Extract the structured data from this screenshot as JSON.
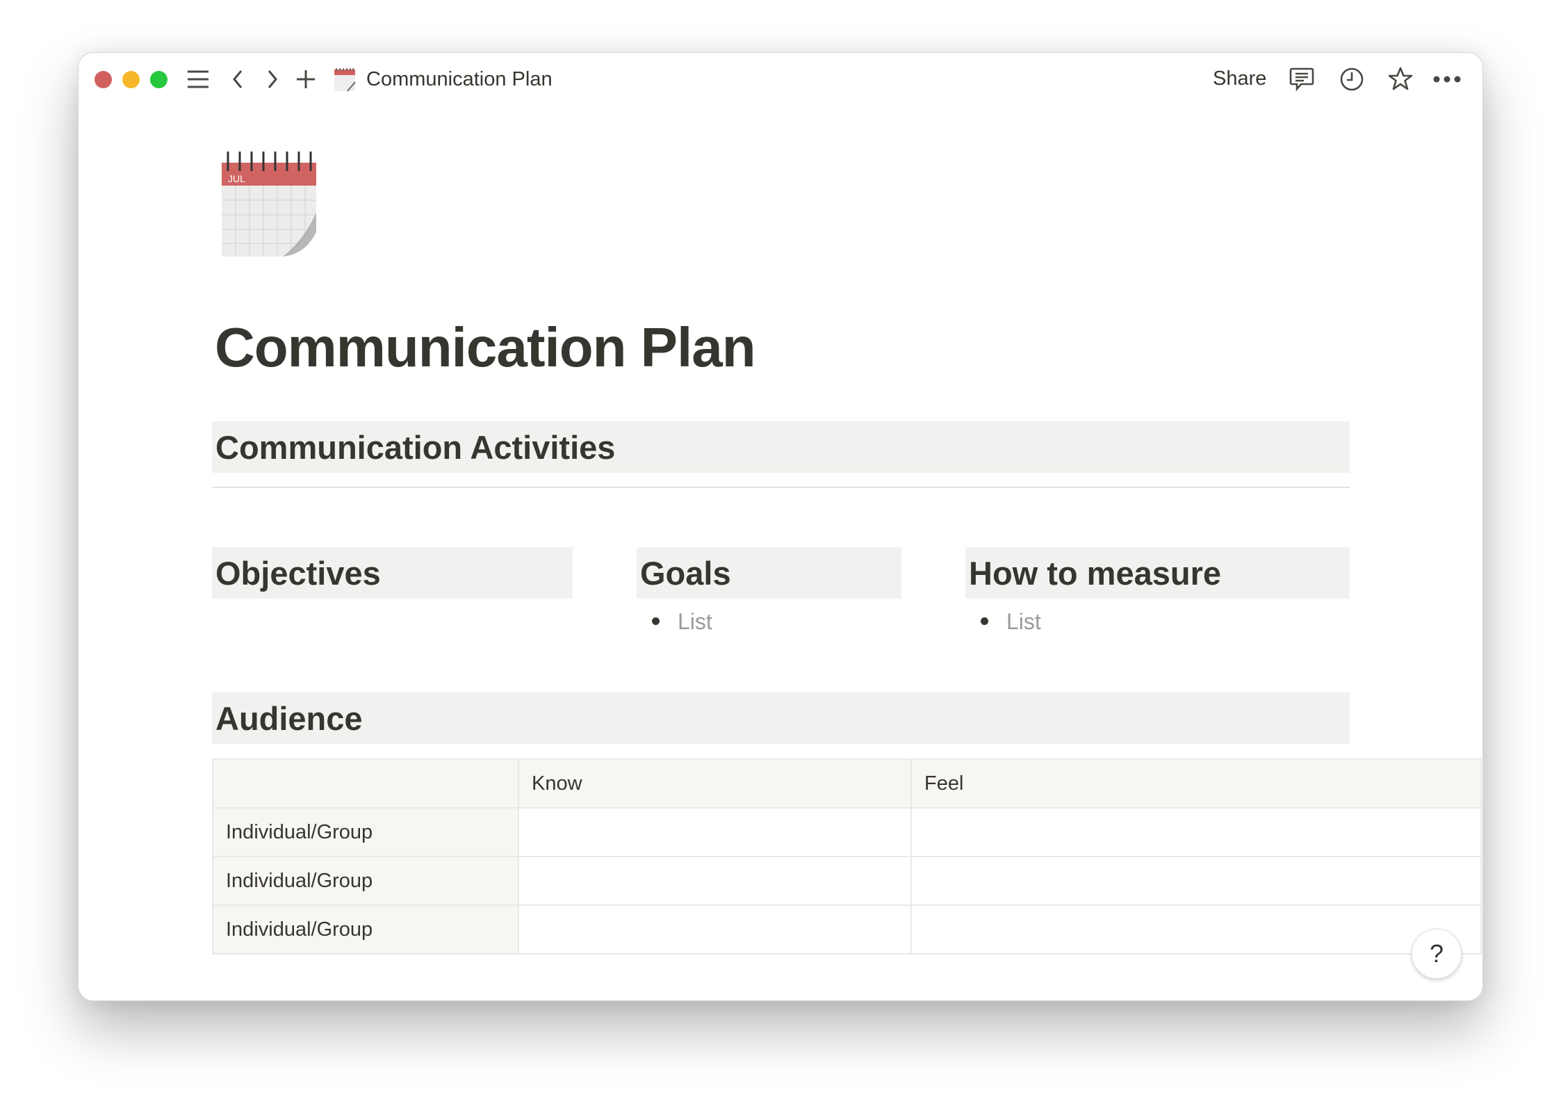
{
  "window": {
    "traffic_colors": {
      "close": "#d0605e",
      "minimize": "#f6b829",
      "maximize": "#28c740"
    }
  },
  "toolbar": {
    "page_title": "Communication Plan",
    "share_label": "Share",
    "icons": [
      "menu-icon",
      "back-icon",
      "forward-icon",
      "plus-icon",
      "comment-icon",
      "history-icon",
      "star-icon",
      "more-icon"
    ]
  },
  "page": {
    "icon": "spiral-calendar-icon",
    "title": "Communication Plan",
    "section_activities": "Communication Activities",
    "columns": [
      {
        "heading": "Objectives",
        "items": []
      },
      {
        "heading": "Goals",
        "items": [
          "List"
        ]
      },
      {
        "heading": "How to measure",
        "items": [
          "List"
        ]
      }
    ],
    "audience": {
      "heading": "Audience",
      "table": {
        "headers": [
          "",
          "Know",
          "Feel"
        ],
        "rows": [
          [
            "Individual/Group",
            "",
            ""
          ],
          [
            "Individual/Group",
            "",
            ""
          ],
          [
            "Individual/Group",
            "",
            ""
          ]
        ]
      }
    }
  },
  "help": {
    "label": "?"
  }
}
